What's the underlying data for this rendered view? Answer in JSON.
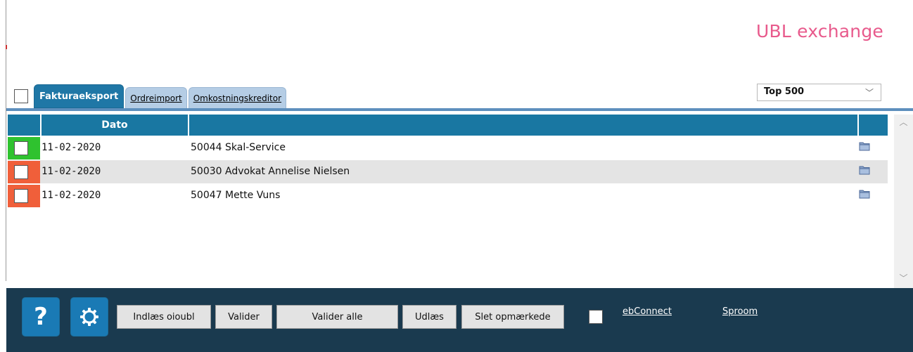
{
  "app": {
    "title": "UBL exchange"
  },
  "tabs": [
    {
      "label": "Fakturaeksport",
      "active": true
    },
    {
      "label": "Ordreimport",
      "active": false
    },
    {
      "label": "Omkostningskreditor",
      "active": false
    }
  ],
  "filter": {
    "selected": "Top 500"
  },
  "table": {
    "columns": [
      "Dato",
      ""
    ],
    "rows": [
      {
        "status_color": "#2fc22f",
        "date": "11-02-2020",
        "name": "50044 Skal-Service"
      },
      {
        "status_color": "#f05f3a",
        "date": "11-02-2020",
        "name": "50030 Advokat Annelise Nielsen"
      },
      {
        "status_color": "#f05f3a",
        "date": "11-02-2020",
        "name": "50047 Mette Vuns"
      }
    ]
  },
  "footer": {
    "help_label": "?",
    "buttons": {
      "import": "Indlæs oioubl",
      "validate": "Valider",
      "validate_all": "Valider alle",
      "export": "Udlæs",
      "delete_marked": "Slet opmærkede"
    },
    "links": {
      "ebconnect": "ebConnect",
      "sproom": "Sproom"
    }
  },
  "icons": {
    "help": "question-icon",
    "settings": "gear-icon",
    "row_action": "folder-icon"
  },
  "colors": {
    "accent": "#1977a2",
    "title": "#e85a8c",
    "footer": "#1a3a4f"
  }
}
